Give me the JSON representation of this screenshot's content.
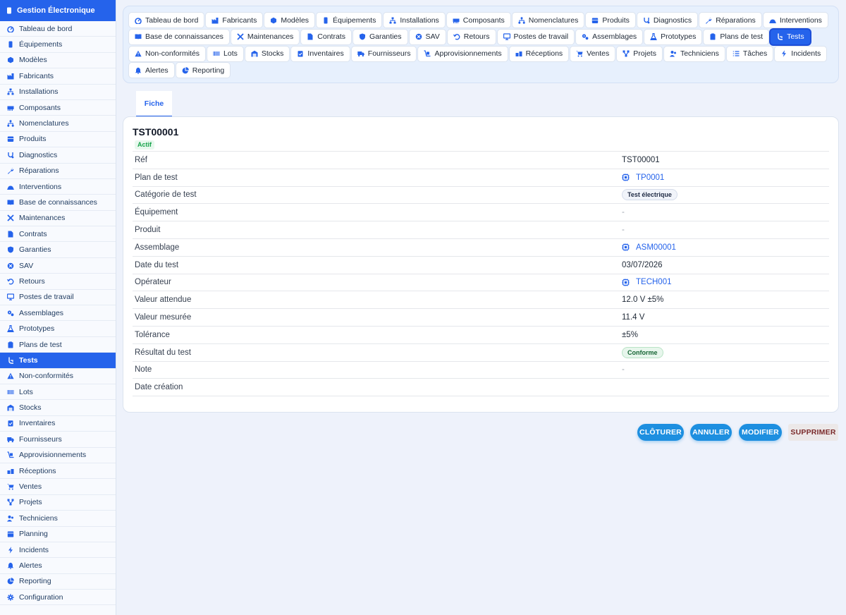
{
  "app": {
    "title": "Gestion Électronique"
  },
  "sidebar": {
    "items": [
      {
        "label": "Tableau de bord",
        "icon": "dashboard-icon"
      },
      {
        "label": "Équipements",
        "icon": "device-icon"
      },
      {
        "label": "Modèles",
        "icon": "cube-icon"
      },
      {
        "label": "Fabricants",
        "icon": "factory-icon"
      },
      {
        "label": "Installations",
        "icon": "sitemap-icon"
      },
      {
        "label": "Composants",
        "icon": "memory-icon"
      },
      {
        "label": "Nomenclatures",
        "icon": "hierarchy-icon"
      },
      {
        "label": "Produits",
        "icon": "box-icon"
      },
      {
        "label": "Diagnostics",
        "icon": "stethoscope-icon"
      },
      {
        "label": "Réparations",
        "icon": "wrench-icon"
      },
      {
        "label": "Interventions",
        "icon": "helmet-icon"
      },
      {
        "label": "Base de connaissances",
        "icon": "book-icon"
      },
      {
        "label": "Maintenances",
        "icon": "tools-icon"
      },
      {
        "label": "Contrats",
        "icon": "document-icon"
      },
      {
        "label": "Garanties",
        "icon": "shield-icon"
      },
      {
        "label": "SAV",
        "icon": "support-icon"
      },
      {
        "label": "Retours",
        "icon": "return-icon"
      },
      {
        "label": "Postes de travail",
        "icon": "monitor-icon"
      },
      {
        "label": "Assemblages",
        "icon": "gears-icon"
      },
      {
        "label": "Prototypes",
        "icon": "flask-icon"
      },
      {
        "label": "Plans de test",
        "icon": "clipboard-icon"
      },
      {
        "label": "Tests",
        "icon": "test-hand-icon",
        "active": true
      },
      {
        "label": "Non-conformités",
        "icon": "warning-icon"
      },
      {
        "label": "Lots",
        "icon": "barcode-icon"
      },
      {
        "label": "Stocks",
        "icon": "warehouse-icon"
      },
      {
        "label": "Inventaires",
        "icon": "clipboard-check-icon"
      },
      {
        "label": "Fournisseurs",
        "icon": "truck-icon"
      },
      {
        "label": "Approvisionnements",
        "icon": "dolly-icon"
      },
      {
        "label": "Réceptions",
        "icon": "receive-icon"
      },
      {
        "label": "Ventes",
        "icon": "cart-icon"
      },
      {
        "label": "Projets",
        "icon": "project-icon"
      },
      {
        "label": "Techniciens",
        "icon": "users-icon"
      },
      {
        "label": "Planning",
        "icon": "calendar-icon"
      },
      {
        "label": "Incidents",
        "icon": "bolt-icon"
      },
      {
        "label": "Alertes",
        "icon": "bell-icon"
      },
      {
        "label": "Reporting",
        "icon": "chart-pie-icon"
      },
      {
        "label": "Configuration",
        "icon": "gear-icon"
      }
    ]
  },
  "tabs": {
    "rows": [
      [
        {
          "label": "Tableau de bord",
          "icon": "dashboard-icon"
        },
        {
          "label": "Fabricants",
          "icon": "factory-icon"
        },
        {
          "label": "Modèles",
          "icon": "cube-icon"
        },
        {
          "label": "Équipements",
          "icon": "device-icon"
        },
        {
          "label": "Installations",
          "icon": "sitemap-icon"
        },
        {
          "label": "Composants",
          "icon": "memory-icon"
        },
        {
          "label": "Nomenclatures",
          "icon": "hierarchy-icon"
        },
        {
          "label": "Produits",
          "icon": "box-icon"
        },
        {
          "label": "Diagnostics",
          "icon": "stethoscope-icon"
        },
        {
          "label": "Réparations",
          "icon": "wrench-icon"
        },
        {
          "label": "Interventions",
          "icon": "helmet-icon"
        }
      ],
      [
        {
          "label": "Base de connaissances",
          "icon": "book-icon"
        },
        {
          "label": "Maintenances",
          "icon": "tools-icon"
        },
        {
          "label": "Contrats",
          "icon": "document-icon"
        },
        {
          "label": "Garanties",
          "icon": "shield-icon"
        },
        {
          "label": "SAV",
          "icon": "support-icon"
        },
        {
          "label": "Retours",
          "icon": "return-icon"
        },
        {
          "label": "Postes de travail",
          "icon": "monitor-icon"
        },
        {
          "label": "Assemblages",
          "icon": "gears-icon"
        },
        {
          "label": "Prototypes",
          "icon": "flask-icon"
        },
        {
          "label": "Plans de test",
          "icon": "clipboard-icon"
        },
        {
          "label": "Tests",
          "icon": "test-hand-icon",
          "active": true
        }
      ],
      [
        {
          "label": "Non-conformités",
          "icon": "warning-icon"
        },
        {
          "label": "Lots",
          "icon": "barcode-icon"
        },
        {
          "label": "Stocks",
          "icon": "warehouse-icon"
        },
        {
          "label": "Inventaires",
          "icon": "clipboard-check-icon"
        },
        {
          "label": "Fournisseurs",
          "icon": "truck-icon"
        },
        {
          "label": "Approvisionnements",
          "icon": "dolly-icon"
        },
        {
          "label": "Réceptions",
          "icon": "receive-icon"
        },
        {
          "label": "Ventes",
          "icon": "cart-icon"
        },
        {
          "label": "Projets",
          "icon": "project-icon"
        },
        {
          "label": "Techniciens",
          "icon": "users-icon"
        },
        {
          "label": "Tâches",
          "icon": "list-icon"
        },
        {
          "label": "Incidents",
          "icon": "bolt-icon"
        }
      ],
      [
        {
          "label": "Alertes",
          "icon": "bell-icon"
        },
        {
          "label": "Reporting",
          "icon": "chart-pie-icon"
        }
      ]
    ]
  },
  "subtab": {
    "label": "Fiche"
  },
  "record": {
    "title": "TST00001",
    "status": "Actif",
    "fields": [
      {
        "label": "Réf",
        "value": "TST00001",
        "type": "text"
      },
      {
        "label": "Plan de test",
        "value": "TP0001",
        "type": "link"
      },
      {
        "label": "Catégorie de test",
        "value": "Test électrique",
        "type": "pill"
      },
      {
        "label": "Équipement",
        "value": "-",
        "type": "empty"
      },
      {
        "label": "Produit",
        "value": "-",
        "type": "empty"
      },
      {
        "label": "Assemblage",
        "value": "ASM00001",
        "type": "link"
      },
      {
        "label": "Date du test",
        "value": "03/07/2026",
        "type": "text"
      },
      {
        "label": "Opérateur",
        "value": "TECH001",
        "type": "link"
      },
      {
        "label": "Valeur attendue",
        "value": "12.0 V ±5%",
        "type": "text"
      },
      {
        "label": "Valeur mesurée",
        "value": "11.4 V",
        "type": "text"
      },
      {
        "label": "Tolérance",
        "value": "±5%",
        "type": "text"
      },
      {
        "label": "Résultat du test",
        "value": "Conforme",
        "type": "pill-green"
      },
      {
        "label": "Note",
        "value": "-",
        "type": "empty"
      },
      {
        "label": "Date création",
        "value": "",
        "type": "text"
      }
    ]
  },
  "actions": {
    "close_label": "CLÔTURER",
    "cancel_label": "ANNULER",
    "edit_label": "MODIFIER",
    "delete_label": "SUPPRIMER"
  },
  "colors": {
    "accent": "#2563eb",
    "button_primary": "#1d8fe0",
    "success": "#16a34a"
  }
}
